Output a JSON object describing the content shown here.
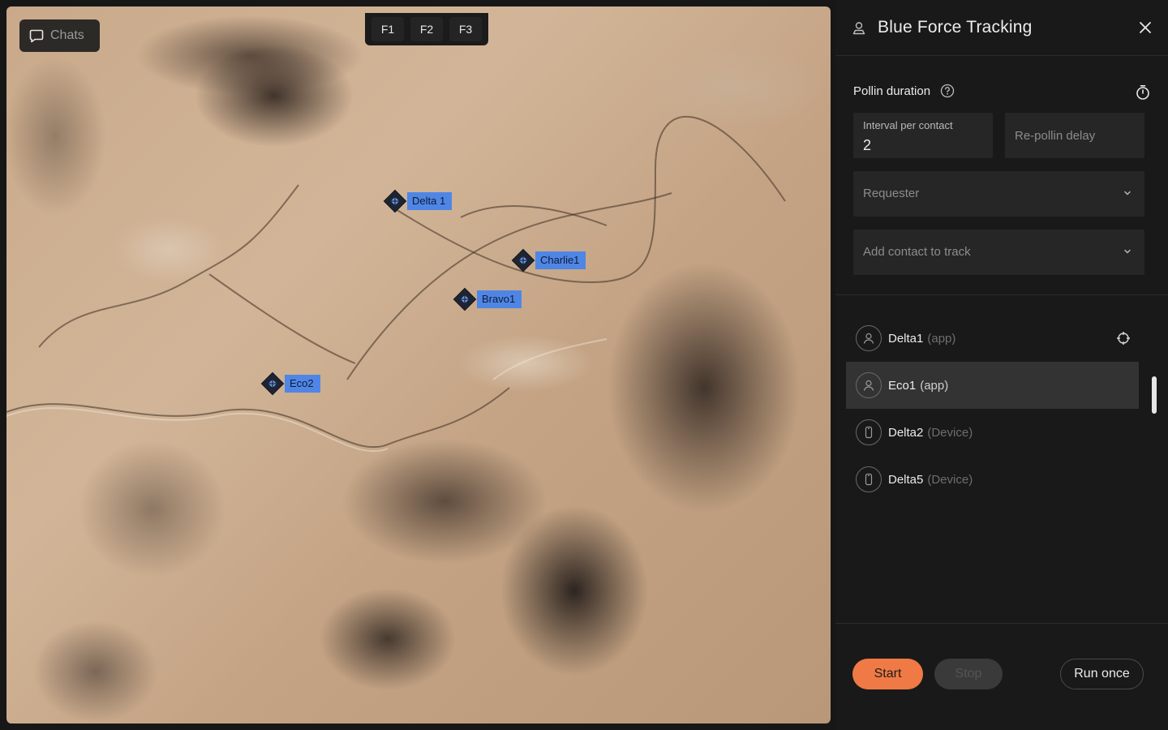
{
  "map": {
    "chats_label": "Chats",
    "function_keys": [
      "F1",
      "F2",
      "F3"
    ],
    "markers": [
      {
        "label": "Delta 1"
      },
      {
        "label": "Charlie1"
      },
      {
        "label": "Bravo1"
      },
      {
        "label": "Eco2"
      }
    ],
    "marker_color": "#4f86e6"
  },
  "panel": {
    "title": "Blue Force Tracking",
    "polling": {
      "section_title": "Pollin duration",
      "interval": {
        "label": "Interval per contact",
        "value": "2"
      },
      "repoll_delay": {
        "placeholder": "Re-pollin delay"
      },
      "requester": {
        "placeholder": "Requester"
      },
      "add_contact": {
        "placeholder": "Add contact to track"
      }
    },
    "contacts": [
      {
        "name": "Delta1",
        "type": "(app)",
        "kind": "user"
      },
      {
        "name": "Eco1",
        "type": "(app)",
        "kind": "user",
        "selected": true
      },
      {
        "name": "Delta2",
        "type": "(Device)",
        "kind": "device"
      },
      {
        "name": "Delta5",
        "type": "(Device)",
        "kind": "device"
      }
    ],
    "actions": {
      "start": "Start",
      "stop": "Stop",
      "run_once": "Run once"
    },
    "accent_color": "#f07a45"
  }
}
